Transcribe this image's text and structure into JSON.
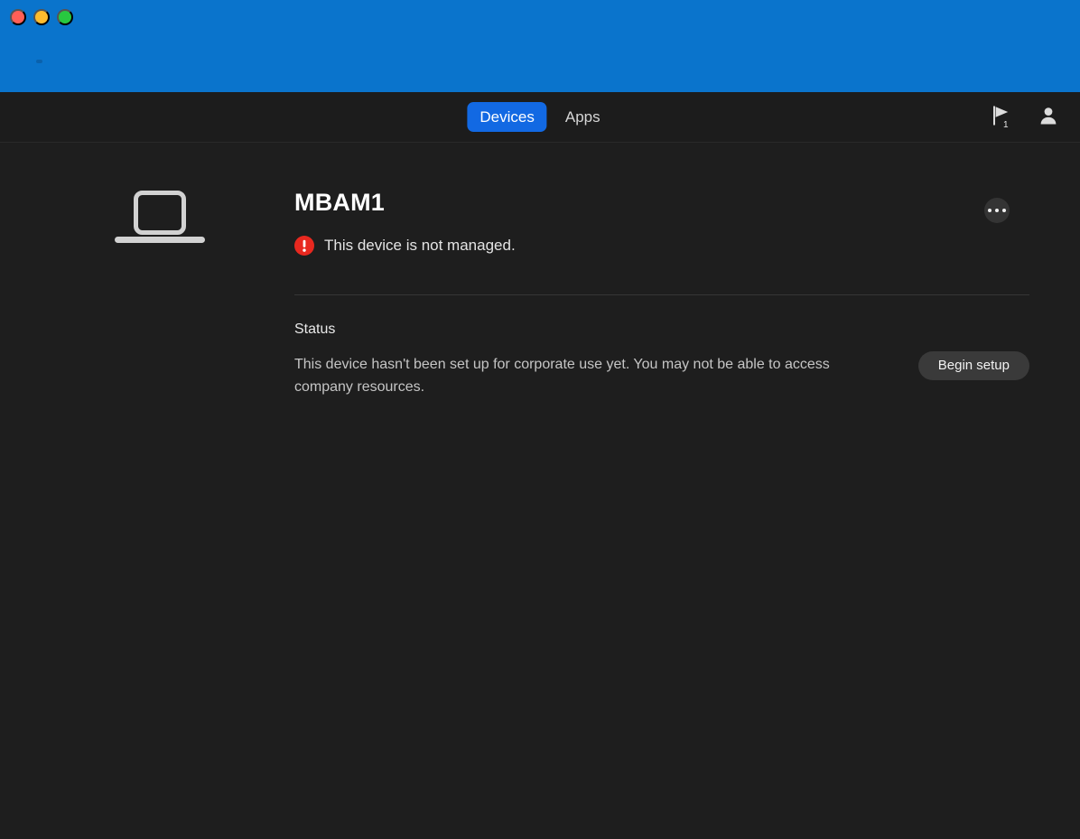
{
  "window": {
    "traffic_lights": [
      {
        "name": "close",
        "color": "#ff5f57"
      },
      {
        "name": "minimize",
        "color": "#febc2e"
      },
      {
        "name": "maximize",
        "color": "#28c840"
      }
    ],
    "titlebar_color": "#0a74cc"
  },
  "nav": {
    "tabs": [
      {
        "label": "Devices",
        "active": true
      },
      {
        "label": "Apps",
        "active": false
      }
    ],
    "flag_icon": "flag-icon",
    "flag_badge": "1",
    "account_icon": "person-icon"
  },
  "device": {
    "icon": "laptop-icon",
    "name": "MBAM1",
    "managed_status": "This device is not managed.",
    "managed_status_icon": "alert-circle-icon",
    "managed_status_color": "#e8281f",
    "overflow_menu_label": "More options"
  },
  "status": {
    "heading": "Status",
    "description": "This device hasn't been set up for corporate use yet. You may not be able to access company resources.",
    "action_label": "Begin setup"
  }
}
